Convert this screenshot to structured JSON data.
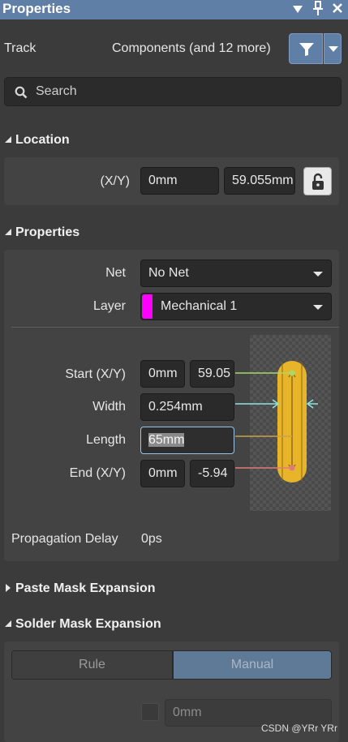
{
  "title": "Properties",
  "header_controls": {
    "menu_icon": "dropdown-triangle",
    "pin_icon": "pin",
    "close_icon": "close"
  },
  "object_type": "Track",
  "filter": {
    "summary": "Components (and 12 more)",
    "icon": "funnel"
  },
  "search": {
    "placeholder": "Search",
    "icon": "magnifier"
  },
  "sections": {
    "location": {
      "title": "Location",
      "expanded": true,
      "xy_label": "(X/Y)",
      "x": "0mm",
      "y": "59.055mm",
      "lock_icon": "padlock-open"
    },
    "properties": {
      "title": "Properties",
      "expanded": true,
      "net_label": "Net",
      "net_value": "No Net",
      "layer_label": "Layer",
      "layer_value": "Mechanical 1",
      "layer_color": "#ff00ff",
      "start_label": "Start (X/Y)",
      "start_x": "0mm",
      "start_y": "59.05",
      "width_label": "Width",
      "width_value": "0.254mm",
      "length_label": "Length",
      "length_value": "65mm",
      "end_label": "End (X/Y)",
      "end_x": "0mm",
      "end_y": "-5.94",
      "prop_delay_label": "Propagation Delay",
      "prop_delay_value": "0ps"
    },
    "paste_mask": {
      "title": "Paste Mask Expansion",
      "expanded": false
    },
    "solder_mask": {
      "title": "Solder Mask Expansion",
      "expanded": true,
      "mode_rule": "Rule",
      "mode_manual": "Manual",
      "value": "0mm"
    }
  },
  "colors": {
    "accent": "#5f7fa6",
    "track_preview": "#e8b52a",
    "start_marker": "#a8d86a",
    "width_marker": "#8ee3e0",
    "length_marker": "#c9a24a",
    "end_marker": "#e07a7a"
  },
  "watermark": "CSDN @YRr YRr"
}
